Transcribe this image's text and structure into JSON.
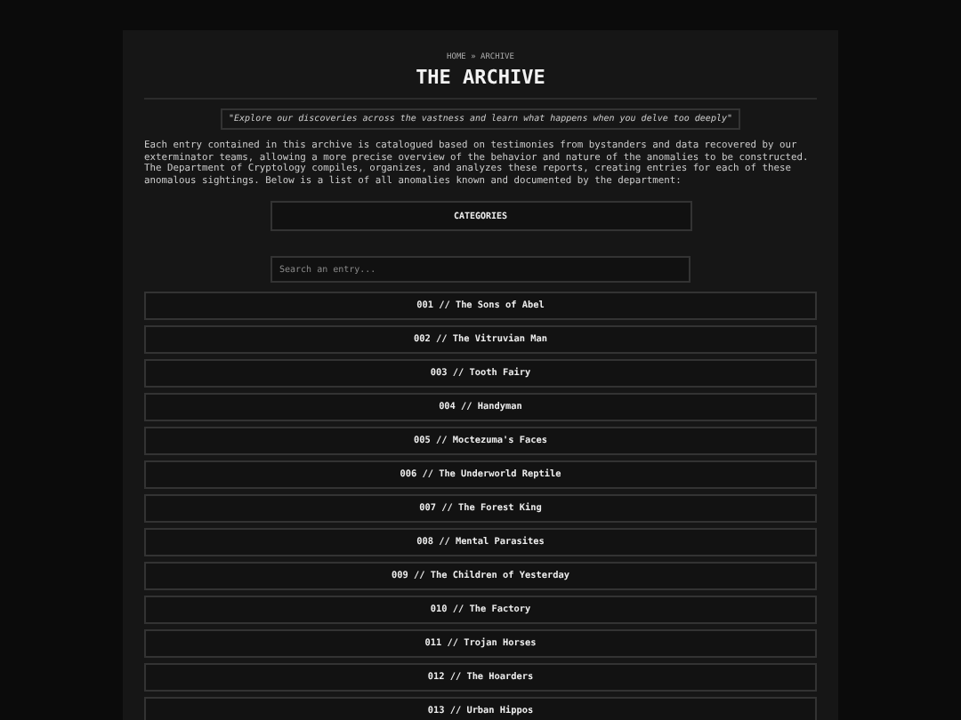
{
  "breadcrumb": "HOME » ARCHIVE",
  "title": "THE ARCHIVE",
  "quote": "\"Explore our discoveries across the vastness and learn what happens when you delve too deeply\"",
  "intro": "Each entry contained in this archive is catalogued based on testimonies from bystanders and data recovered by our exterminator teams, allowing a more precise overview of the behavior and nature of the anomalies to be constructed. The Department of Cryptology compiles, organizes, and analyzes these reports, creating entries for each of these anomalous sightings. Below is a list of all anomalies known and documented by the department:",
  "categories_button": "CATEGORIES",
  "search": {
    "placeholder": "Search an entry..."
  },
  "entries": [
    "001 // The Sons of Abel",
    "002 // The Vitruvian Man",
    "003 // Tooth Fairy",
    "004 // Handyman",
    "005 // Moctezuma's Faces",
    "006 // The Underworld Reptile",
    "007 // The Forest King",
    "008 // Mental Parasites",
    "009 // The Children of Yesterday",
    "010 // The Factory",
    "011 // Trojan Horses",
    "012 // The Hoarders",
    "013 // Urban Hippos"
  ]
}
